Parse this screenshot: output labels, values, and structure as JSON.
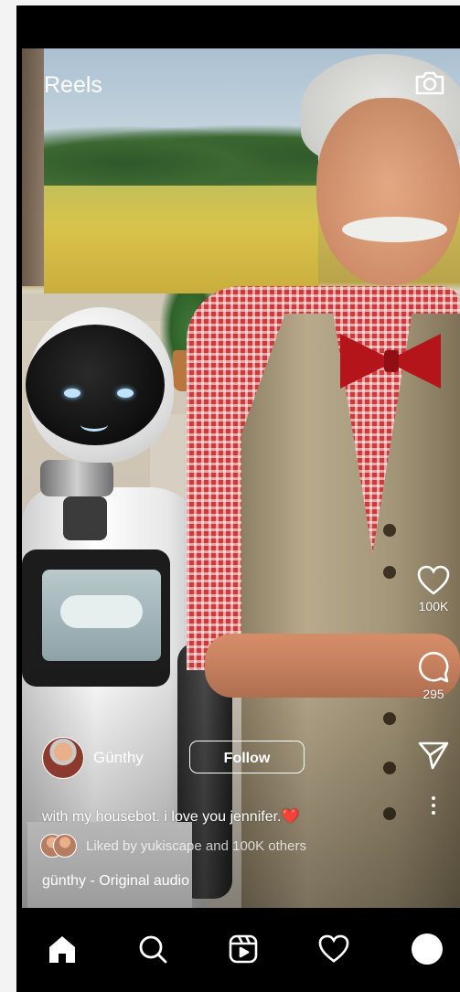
{
  "header": {
    "title": "Reels",
    "camera_icon": "camera-icon"
  },
  "actions": {
    "like": {
      "icon": "heart-icon",
      "count": "100K"
    },
    "comment": {
      "icon": "comment-icon",
      "count": "295"
    },
    "share": {
      "icon": "send-icon"
    },
    "more": {
      "icon": "more-vertical-icon"
    }
  },
  "post": {
    "author": "Günthy",
    "follow_label": "Follow",
    "caption": "with my housebot. i love you jennifer.",
    "caption_emoji": "❤️",
    "liked_by": "Liked by yukiscape and 100K others",
    "audio": "günthy - Original audio"
  },
  "tabbar": {
    "items": [
      {
        "name": "home",
        "icon": "home-icon",
        "active": true
      },
      {
        "name": "search",
        "icon": "search-icon"
      },
      {
        "name": "reels",
        "icon": "reels-icon"
      },
      {
        "name": "activity",
        "icon": "heart-icon"
      },
      {
        "name": "profile",
        "icon": "profile-avatar"
      }
    ]
  },
  "colors": {
    "background": "#000000",
    "text": "#ffffff",
    "heart": "#e5362f"
  }
}
